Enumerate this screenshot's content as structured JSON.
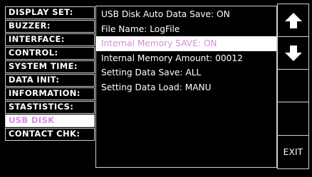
{
  "menu": {
    "items": [
      {
        "label": "DISPLAY SET:"
      },
      {
        "label": "BUZZER:"
      },
      {
        "label": "INTERFACE:"
      },
      {
        "label": "CONTROL:"
      },
      {
        "label": "SYSTEM TIME:"
      },
      {
        "label": "DATA INIT:"
      },
      {
        "label": "INFORMATION:"
      },
      {
        "label": "STASTISTICS:"
      },
      {
        "label": "USB DISK"
      },
      {
        "label": "CONTACT CHK:"
      }
    ],
    "active_index": 8
  },
  "settings": {
    "rows": [
      {
        "label": "USB Disk Auto Data Save: ON"
      },
      {
        "label": "File Name: LogFile"
      },
      {
        "label": "Internal Memory SAVE: ON"
      },
      {
        "label": "Internal Memory Amount: 00012"
      },
      {
        "label": "Setting Data Save: ALL"
      },
      {
        "label": "Setting Data Load: MANU"
      }
    ],
    "highlight_index": 2
  },
  "softkeys": {
    "up_icon": "arrow-up-icon",
    "down_icon": "arrow-down-icon",
    "exit_label": "EXIT"
  },
  "colors": {
    "background": "#000000",
    "border": "#cfcfcf",
    "text": "#ffffff",
    "highlight_bg": "#ffffff",
    "highlight_text": "#d98be0"
  }
}
